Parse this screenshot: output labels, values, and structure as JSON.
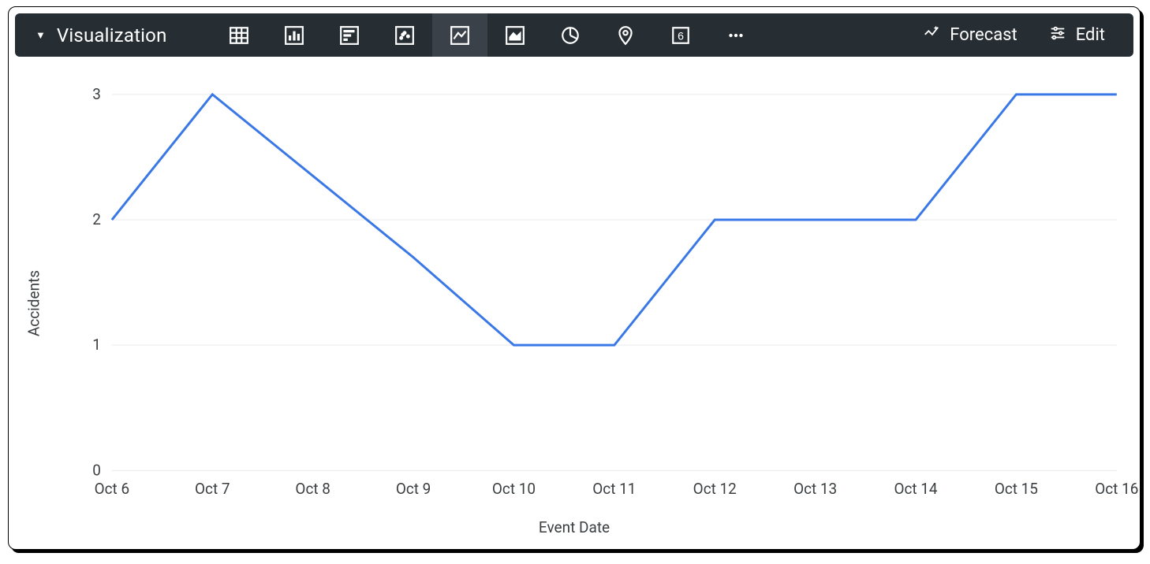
{
  "toolbar": {
    "title": "Visualization",
    "forecast_label": "Forecast",
    "edit_label": "Edit",
    "icons": [
      {
        "name": "table-icon"
      },
      {
        "name": "column-chart-icon"
      },
      {
        "name": "bar-chart-icon"
      },
      {
        "name": "scatter-chart-icon"
      },
      {
        "name": "line-chart-icon",
        "active": true
      },
      {
        "name": "area-chart-icon"
      },
      {
        "name": "pie-chart-icon"
      },
      {
        "name": "map-pin-icon"
      },
      {
        "name": "single-value-icon"
      },
      {
        "name": "more-icon"
      }
    ]
  },
  "chart_data": {
    "type": "line",
    "xlabel": "Event Date",
    "ylabel": "Accidents",
    "categories": [
      "Oct 6",
      "Oct 7",
      "Oct 8",
      "Oct 9",
      "Oct 10",
      "Oct 11",
      "Oct 12",
      "Oct 13",
      "Oct 14",
      "Oct 15",
      "Oct 16"
    ],
    "values": [
      2,
      3,
      2.35,
      1.7,
      1,
      1,
      2,
      2,
      2,
      3,
      3
    ],
    "ylim": [
      0,
      3
    ],
    "yticks": [
      0,
      1,
      2,
      3
    ],
    "grid": true,
    "color": "#3b78e7"
  }
}
